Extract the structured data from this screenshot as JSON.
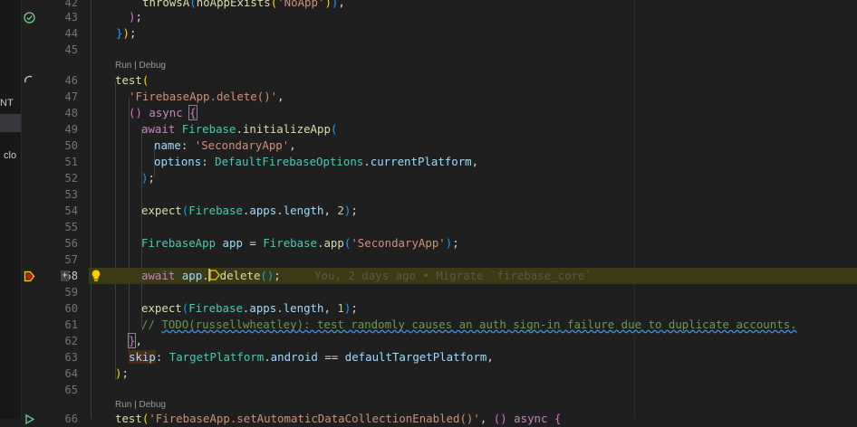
{
  "sidebar": {
    "fragment_1": "NT",
    "fragment_2": "clo"
  },
  "codelens": {
    "run_debug": "Run | Debug"
  },
  "lines": {
    "n42": "42",
    "n43": "43",
    "n44": "44",
    "n45": "45",
    "n46": "46",
    "n47": "47",
    "n48": "48",
    "n49": "49",
    "n50": "50",
    "n51": "51",
    "n52": "52",
    "n53": "53",
    "n54": "54",
    "n55": "55",
    "n56": "56",
    "n57": "57",
    "n58": "58",
    "n59": "59",
    "n60": "60",
    "n61": "61",
    "n62": "62",
    "n63": "63",
    "n64": "64",
    "n65": "65",
    "n66": "66"
  },
  "code": {
    "l42_fn": "throwsA",
    "l42_arg": "noAppExists",
    "l42_str": "'NoApp'",
    "l46_fn": "test",
    "l47_str": "'FirebaseApp.delete()'",
    "l48_async": "async",
    "l49_await": "await",
    "l49_cls": "Firebase",
    "l49_fn": "initializeApp",
    "l50_key": "name",
    "l50_str": "'SecondaryApp'",
    "l51_key": "options",
    "l51_cls": "DefaultFirebaseOptions",
    "l51_prop": "currentPlatform",
    "l54_fn": "expect",
    "l54_cls": "Firebase",
    "l54_p1": "apps",
    "l54_p2": "length",
    "l54_num": "2",
    "l56_type": "FirebaseApp",
    "l56_var": "app",
    "l56_cls": "Firebase",
    "l56_fn": "app",
    "l56_str": "'SecondaryApp'",
    "l58_await": "await",
    "l58_var": "app",
    "l58_fn": "delete",
    "l58_blame": "You, 2 days ago • Migrate `firebase_core`",
    "l60_fn": "expect",
    "l60_cls": "Firebase",
    "l60_p1": "apps",
    "l60_p2": "length",
    "l60_num": "1",
    "l61_comment_a": "// ",
    "l61_comment_b": "TODO(russellwheatley): test randomly causes an auth sign-in failure due to duplicate accounts.",
    "l63_skip": "skip",
    "l63_cls": "TargetPlatform",
    "l63_prop": "android",
    "l63_var": "defaultTargetPlatform",
    "l66_fn": "test",
    "l66_str": "'FirebaseApp.setAutomaticDataCollectionEnabled()'",
    "l66_async": "async"
  },
  "colors": {
    "background": "#1f1f1f",
    "line_highlight": "#3a3a17",
    "keyword": "#c586c0",
    "type": "#4ec9b0",
    "string": "#ce9178"
  },
  "icons": {
    "l43": "test-passed-icon",
    "l46": "test-running-icon",
    "l58": "breakpoint-current-icon",
    "l58b": "lightbulb-icon",
    "l66": "run-test-icon"
  }
}
